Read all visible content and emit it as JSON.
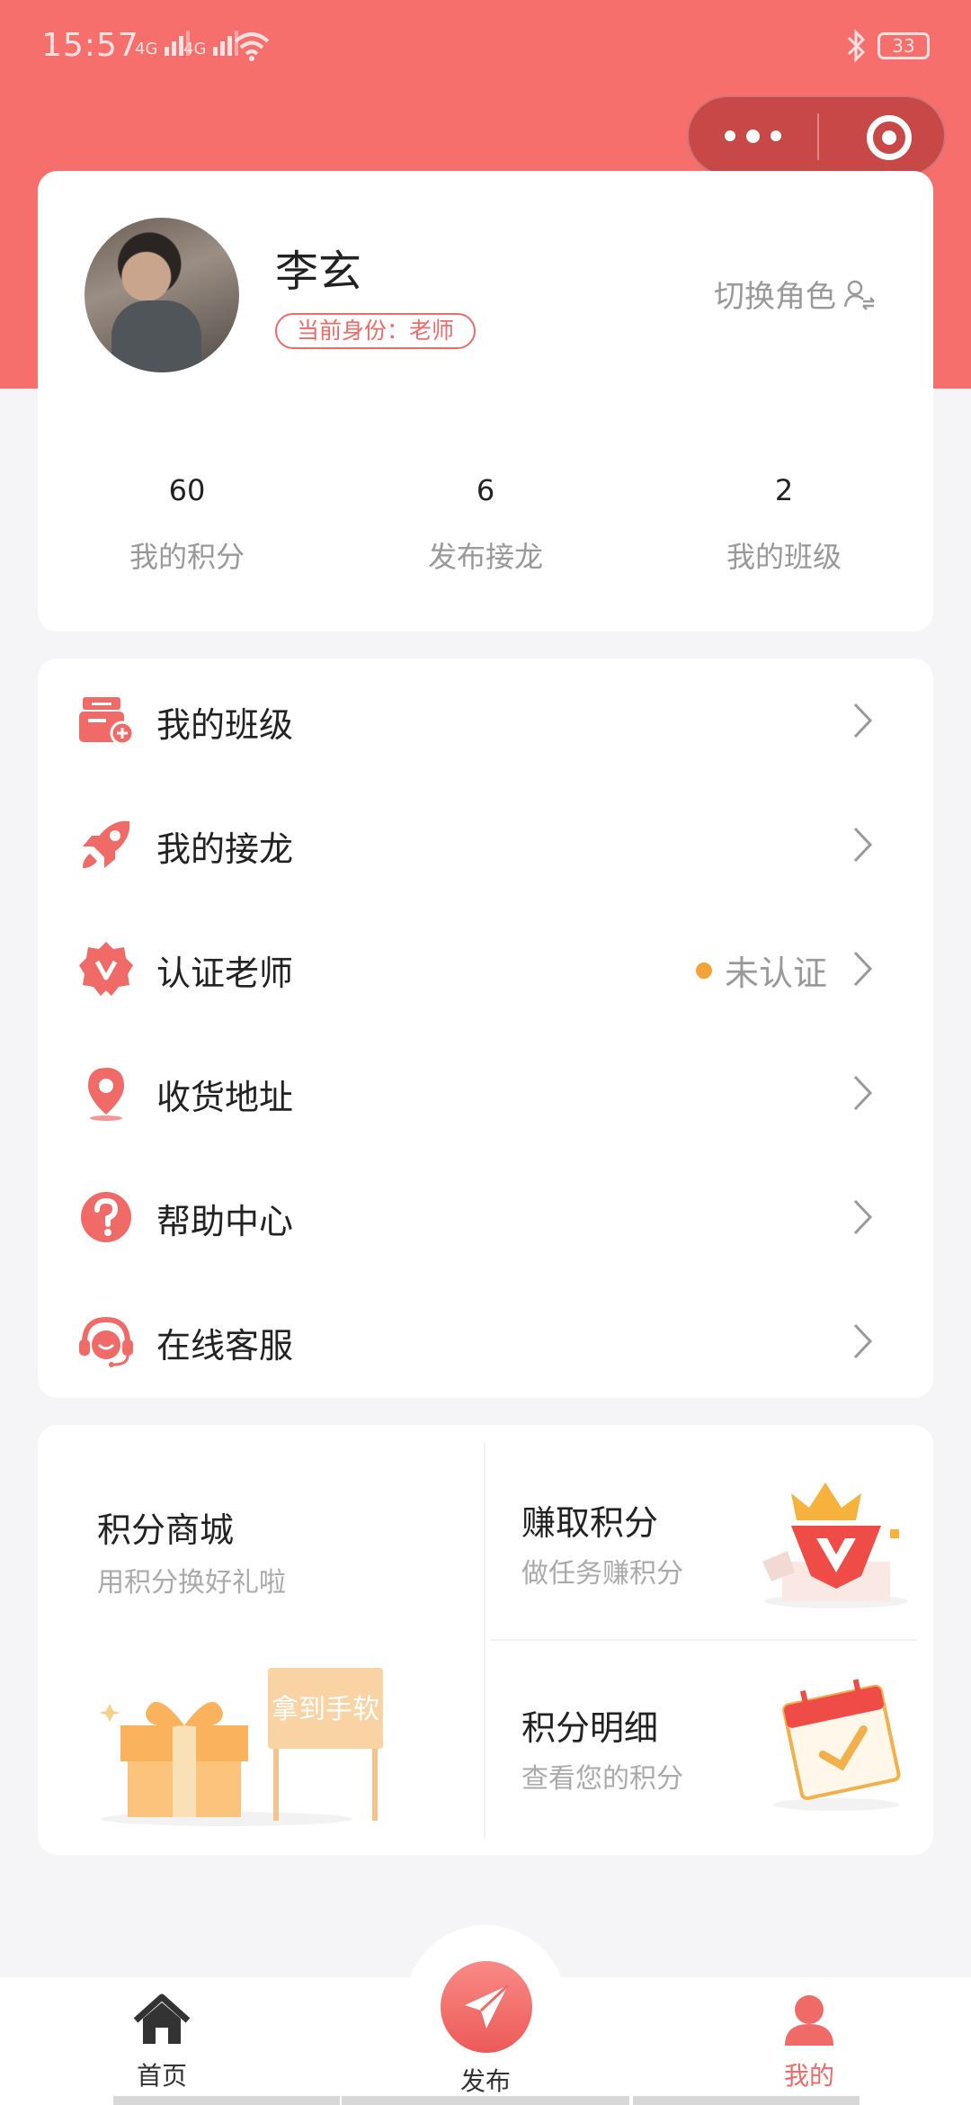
{
  "status_bar": {
    "time": "15:57",
    "signal_1": "4G",
    "signal_2": "4G",
    "battery": "33"
  },
  "profile": {
    "name": "李玄",
    "identity": "当前身份：老师",
    "switch_role": "切换角色"
  },
  "stats": [
    {
      "value": "60",
      "label": "我的积分"
    },
    {
      "value": "6",
      "label": "发布接龙"
    },
    {
      "value": "2",
      "label": "我的班级"
    }
  ],
  "menu": [
    {
      "label": "我的班级",
      "icon": "class-add-icon"
    },
    {
      "label": "我的接龙",
      "icon": "rocket-icon"
    },
    {
      "label": "认证老师",
      "icon": "verified-badge-icon",
      "status": "未认证",
      "status_color": "#f4a23a"
    },
    {
      "label": "收货地址",
      "icon": "location-pin-icon"
    },
    {
      "label": "帮助中心",
      "icon": "help-icon"
    },
    {
      "label": "在线客服",
      "icon": "headset-icon"
    }
  ],
  "points": {
    "mall": {
      "title": "积分商城",
      "subtitle": "用积分换好礼啦",
      "sign": "拿到手软"
    },
    "earn": {
      "title": "赚取积分",
      "subtitle": "做任务赚积分"
    },
    "detail": {
      "title": "积分明细",
      "subtitle": "查看您的积分"
    }
  },
  "tabbar": {
    "home": "首页",
    "publish": "发布",
    "mine": "我的",
    "active": "mine"
  },
  "colors": {
    "brand": "#f66f6d",
    "accent": "#f06a68",
    "status_dot": "#f4a23a"
  }
}
